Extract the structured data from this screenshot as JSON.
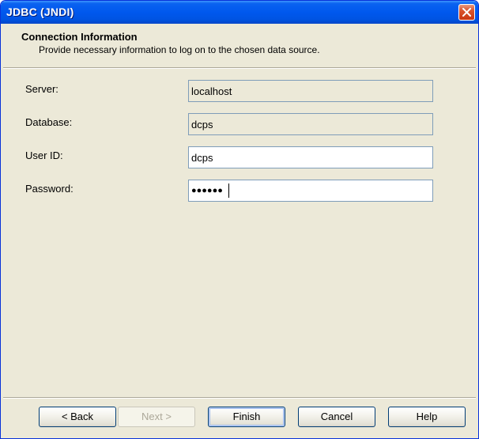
{
  "window": {
    "title": "JDBC (JNDI)",
    "close_icon": "close-icon"
  },
  "header": {
    "title": "Connection Information",
    "subtitle": "Provide necessary information to log on to the chosen data source."
  },
  "form": {
    "server": {
      "label": "Server:",
      "value": "localhost",
      "editable": false
    },
    "database": {
      "label": "Database:",
      "value": "dcps",
      "editable": false
    },
    "user_id": {
      "label": "User ID:",
      "value": "dcps",
      "editable": true
    },
    "password": {
      "label": "Password:",
      "masked_value": "●●●●●●",
      "editable": true,
      "focused": true
    }
  },
  "buttons": {
    "back": "< Back",
    "next": "Next >",
    "finish": "Finish",
    "cancel": "Cancel",
    "help": "Help"
  },
  "colors": {
    "title_bar": "#0054e3",
    "dialog_bg": "#ece9d8",
    "field_border": "#7f9db9"
  }
}
